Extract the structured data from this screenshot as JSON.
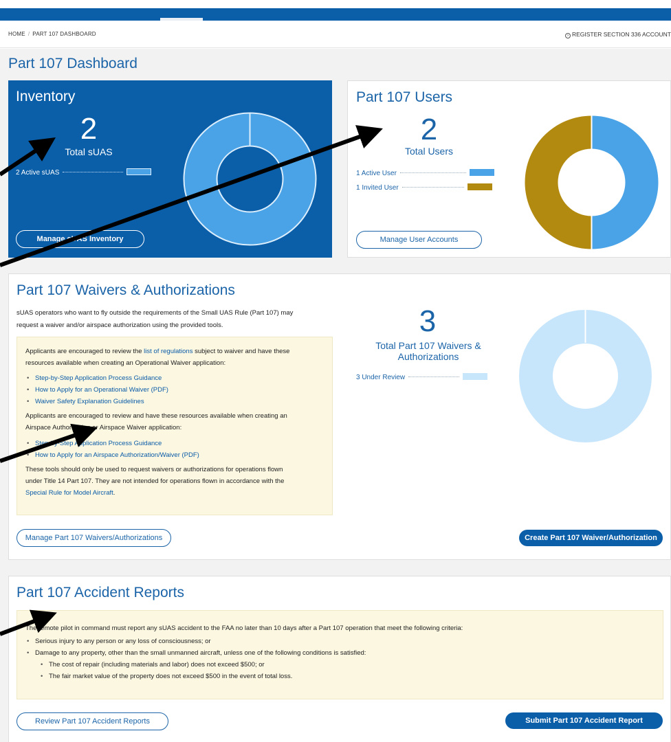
{
  "breadcrumb": {
    "home": "HOME",
    "separator": "/",
    "current": "PART 107 DASHBOARD"
  },
  "register_link": "REGISTER SECTION 336 ACCOUNT",
  "page_title": "Part 107 Dashboard",
  "inventory": {
    "title": "Inventory",
    "total_number": "2",
    "total_label": "Total sUAS",
    "legend": [
      {
        "label": "2 Active sUAS",
        "color": "#4aa3e6"
      }
    ],
    "manage_button": "Manage sUAS Inventory",
    "donut": {
      "segments": [
        {
          "label": "Active sUAS",
          "value": 2,
          "color": "#4aa3e6"
        }
      ]
    }
  },
  "users": {
    "title": "Part 107 Users",
    "total_number": "2",
    "total_label": "Total Users",
    "legend": [
      {
        "label": "1 Active User",
        "color": "#4aa3e6"
      },
      {
        "label": "1 Invited User",
        "color": "#b38a10"
      }
    ],
    "manage_button": "Manage User Accounts",
    "donut": {
      "segments": [
        {
          "label": "Active User",
          "value": 1,
          "color": "#4aa3e6"
        },
        {
          "label": "Invited User",
          "value": 1,
          "color": "#b38a10"
        }
      ]
    }
  },
  "waivers": {
    "title": "Part 107 Waivers & Authorizations",
    "intro_line1": "sUAS operators who want to fly outside the requirements of the Small UAS Rule (Part 107) may",
    "intro_line2": "request a waiver and/or airspace authorization using the provided tools.",
    "note": {
      "p1_before": "Applicants are encouraged to review the ",
      "p1_link": "list of regulations",
      "p1_after": " subject to waiver and have these",
      "p1_line2": "resources available when creating an Operational Waiver application:",
      "list1": [
        "Step-by-Step Application Process Guidance",
        "How to Apply for an Operational Waiver (PDF)",
        "Waiver Safety Explanation Guidelines"
      ],
      "p2_line1": "Applicants are encouraged to review and have these resources available when creating an",
      "p2_line2": "Airspace Authorization or Airspace Waiver application:",
      "list2": [
        "Step-by-Step Application Process Guidance",
        "How to Apply for an Airspace Authorization/Waiver (PDF)"
      ],
      "p3_line1": "These tools should only be used to request waivers or authorizations for operations flown",
      "p3_line2": "under Title 14 Part 107. They are not intended for operations flown in accordance with the",
      "p3_link": "Special Rule for Model Aircraft",
      "p3_end": "."
    },
    "total_number": "3",
    "total_label_1": "Total Part 107 Waivers &",
    "total_label_2": "Authorizations",
    "legend": [
      {
        "label": "3 Under Review",
        "color": "#c8e6fb"
      }
    ],
    "manage_button": "Manage Part 107 Waivers/Authorizations",
    "create_button": "Create Part 107 Waiver/Authorization",
    "donut": {
      "segments": [
        {
          "label": "Under Review",
          "value": 3,
          "color": "#c8e6fb"
        }
      ]
    }
  },
  "accidents": {
    "title": "Part 107 Accident Reports",
    "intro": "The remote pilot in command must report any sUAS accident to the FAA no later than 10 days after a Part 107 operation that meet the following criteria:",
    "items": [
      "Serious injury to any person or any loss of consciousness; or",
      "Damage to any property, other than the small unmanned aircraft, unless one of the following conditions is satisfied:"
    ],
    "subitems": [
      "The cost of repair (including materials and labor) does not exceed $500; or",
      "The fair market value of the property does not exceed $500 in the event of total loss."
    ],
    "review_button": "Review Part 107 Accident Reports",
    "submit_button": "Submit Part 107 Accident Report"
  },
  "colors": {
    "brand_blue": "#0b5ea8",
    "light_blue": "#4aa3e6",
    "gold": "#b38a10",
    "pale_blue": "#c8e6fb",
    "note_bg": "#fbf7e1"
  }
}
